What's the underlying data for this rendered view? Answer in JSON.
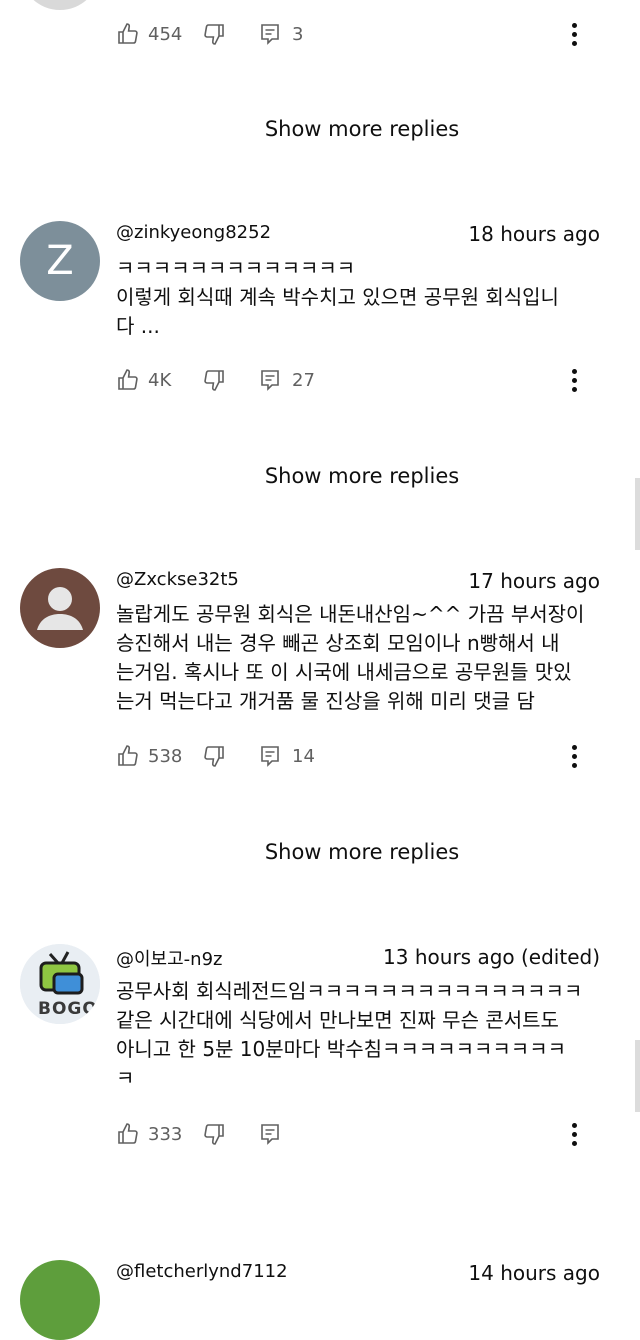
{
  "colors": {
    "text": "#0f0f0f",
    "muted": "#606060",
    "avatar_z_bg": "#7d8f9a",
    "avatar_person_bg": "#6e4a3f",
    "avatar_green_bg": "#5e9e3c"
  },
  "top_comment": {
    "likes": "454",
    "replies": "3"
  },
  "show_more_label": "Show more replies",
  "comments": [
    {
      "avatar_letter": "Z",
      "username": "@zinkyeong8252",
      "timestamp": "18 hours ago",
      "text": "ㅋㅋㅋㅋㅋㅋㅋㅋㅋㅋㅋㅋㅋ\n이렇게 회식때 계속 박수치고 있으면 공무원 회식입니\n다 ...",
      "likes": "4K",
      "replies": "27"
    },
    {
      "username": "@Zxckse32t5",
      "timestamp": "17 hours ago",
      "text": "놀랍게도 공무원 회식은 내돈내산임~^^ 가끔 부서장이\n승진해서 내는 경우 빼곤 상조회 모임이나 n빵해서 내\n는거임. 혹시나 또 이 시국에 내세금으로 공무원들 맛있\n는거 먹는다고 개거품 물 진상을 위해 미리 댓글 담",
      "likes": "538",
      "replies": "14"
    },
    {
      "avatar_text": "BOGO",
      "username": "@이보고-n9z",
      "timestamp": "13 hours ago (edited)",
      "text": "공무사회 회식레전드임ㅋㅋㅋㅋㅋㅋㅋㅋㅋㅋㅋㅋㅋㅋㅋ\n같은 시간대에 식당에서 만나보면 진짜 무슨 콘서트도\n아니고 한 5분 10분마다 박수침ㅋㅋㅋㅋㅋㅋㅋㅋㅋㅋ\nㅋ",
      "likes": "333",
      "replies": ""
    },
    {
      "username": "@fletcherlynd7112",
      "timestamp": "14 hours ago"
    }
  ]
}
